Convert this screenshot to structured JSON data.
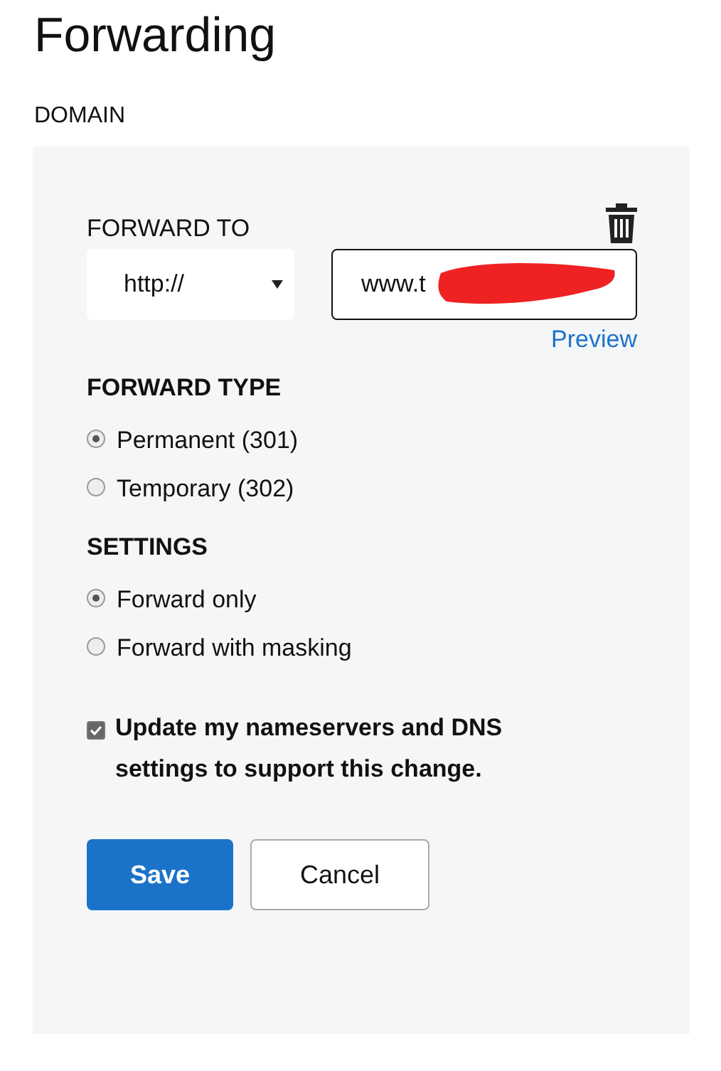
{
  "title": "Forwarding",
  "section_label": "DOMAIN",
  "forward_to": {
    "label": "FORWARD TO",
    "protocol": "http://",
    "url": "www.t",
    "redacted": true,
    "preview_link": "Preview"
  },
  "forward_type": {
    "heading": "FORWARD TYPE",
    "options": [
      {
        "label": "Permanent (301)",
        "selected": true
      },
      {
        "label": "Temporary (302)",
        "selected": false
      }
    ]
  },
  "settings": {
    "heading": "SETTINGS",
    "options": [
      {
        "label": "Forward only",
        "selected": true
      },
      {
        "label": "Forward with masking",
        "selected": false
      }
    ]
  },
  "update_dns": {
    "label": "Update my nameservers and DNS settings to support this change.",
    "checked": true
  },
  "buttons": [
    {
      "label": "Save",
      "kind": "primary"
    },
    {
      "label": "Cancel",
      "kind": "secondary"
    }
  ]
}
